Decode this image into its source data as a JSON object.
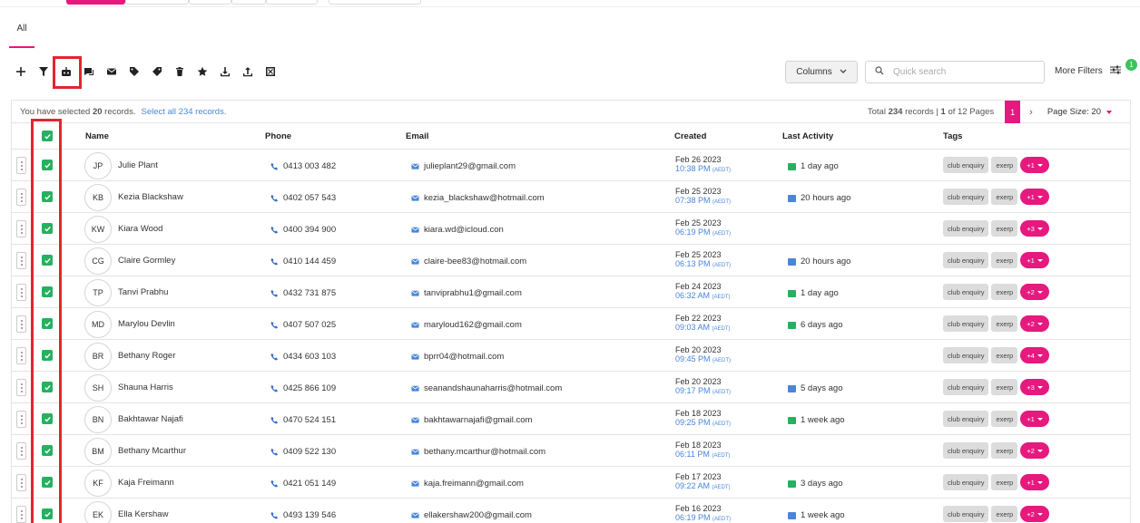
{
  "tabs": {
    "all_label": "All"
  },
  "toolbar": {
    "icons": [
      "add-icon",
      "filter-icon",
      "robot-icon",
      "chat-icon",
      "mail-icon",
      "tag-icon",
      "tag-remove-icon",
      "trash-icon",
      "star-icon",
      "download-icon",
      "upload-icon",
      "merge-icon"
    ],
    "columns_label": "Columns",
    "search_placeholder": "Quick search",
    "more_filters_label": "More Filters",
    "filter_count": "1"
  },
  "info": {
    "selected_prefix": "You have selected",
    "selected_count": "20",
    "selected_suffix": "records.",
    "select_all_label": "Select all 234 records.",
    "total_prefix": "Total",
    "total_count": "234",
    "records_mid": "records |",
    "page_current": "1",
    "page_of": "of 12 Pages",
    "page_size_label": "Page Size: 20"
  },
  "columns": {
    "name": "Name",
    "phone": "Phone",
    "email": "Email",
    "created": "Created",
    "last_activity": "Last Activity",
    "tags": "Tags"
  },
  "colors": {
    "accent": "#e5197e",
    "check": "#27b060",
    "highlight": "#e0262f",
    "link": "#4a86d8"
  },
  "rows": [
    {
      "initials": "JP",
      "name": "Julie Plant",
      "phone": "0413 003 482",
      "email": "julieplant29@gmail.com",
      "date": "Feb 26 2023",
      "time": "10:38 PM",
      "tz": "(AEDT)",
      "activity": "1 day ago",
      "activity_type": "chat",
      "tag1": "club enquiry",
      "tag2": "exerp",
      "more": "+1"
    },
    {
      "initials": "KB",
      "name": "Kezia Blackshaw",
      "phone": "0402 057 543",
      "email": "kezia_blackshaw@hotmail.com",
      "date": "Feb 25 2023",
      "time": "07:38 PM",
      "tz": "(AEDT)",
      "activity": "20 hours ago",
      "activity_type": "mail",
      "tag1": "club enquiry",
      "tag2": "exerp",
      "more": "+1"
    },
    {
      "initials": "KW",
      "name": "Kiara Wood",
      "phone": "0400 394 900",
      "email": "kiara.wd@icloud.con",
      "date": "Feb 25 2023",
      "time": "06:19 PM",
      "tz": "(AEDT)",
      "activity": "",
      "activity_type": "",
      "tag1": "club enquiry",
      "tag2": "exerp",
      "more": "+3"
    },
    {
      "initials": "CG",
      "name": "Claire Gormley",
      "phone": "0410 144 459",
      "email": "claire-bee83@hotmail.com",
      "date": "Feb 25 2023",
      "time": "06:13 PM",
      "tz": "(AEDT)",
      "activity": "20 hours ago",
      "activity_type": "mail",
      "tag1": "club enquiry",
      "tag2": "exerp",
      "more": "+1"
    },
    {
      "initials": "TP",
      "name": "Tanvi Prabhu",
      "phone": "0432 731 875",
      "email": "tanviprabhu1@gmail.com",
      "date": "Feb 24 2023",
      "time": "06:32 AM",
      "tz": "(AEDT)",
      "activity": "1 day ago",
      "activity_type": "chat",
      "tag1": "club enquiry",
      "tag2": "exerp",
      "more": "+2"
    },
    {
      "initials": "MD",
      "name": "Marylou Devlin",
      "phone": "0407 507 025",
      "email": "maryloud162@gmail.com",
      "date": "Feb 22 2023",
      "time": "09:03 AM",
      "tz": "(AEDT)",
      "activity": "6 days ago",
      "activity_type": "chat",
      "tag1": "club enquiry",
      "tag2": "exerp",
      "more": "+2"
    },
    {
      "initials": "BR",
      "name": "Bethany Roger",
      "phone": "0434 603 103",
      "email": "bprr04@hotmail.com",
      "date": "Feb 20 2023",
      "time": "09:45 PM",
      "tz": "(AEDT)",
      "activity": "",
      "activity_type": "",
      "tag1": "club enquiry",
      "tag2": "exerp",
      "more": "+4"
    },
    {
      "initials": "SH",
      "name": "Shauna Harris",
      "phone": "0425 866 109",
      "email": "seanandshaunaharris@hotmail.com",
      "date": "Feb 20 2023",
      "time": "09:17 PM",
      "tz": "(AEDT)",
      "activity": "5 days ago",
      "activity_type": "mail",
      "tag1": "club enquiry",
      "tag2": "exerp",
      "more": "+3"
    },
    {
      "initials": "BN",
      "name": "Bakhtawar Najafi",
      "phone": "0470 524 151",
      "email": "bakhtawarnajafi@gmail.com",
      "date": "Feb 18 2023",
      "time": "09:25 PM",
      "tz": "(AEDT)",
      "activity": "1 week ago",
      "activity_type": "chat",
      "tag1": "club enquiry",
      "tag2": "exerp",
      "more": "+1"
    },
    {
      "initials": "BM",
      "name": "Bethany Mcarthur",
      "phone": "0409 522 130",
      "email": "bethany.mcarthur@hotmail.com",
      "date": "Feb 18 2023",
      "time": "06:11 PM",
      "tz": "(AEDT)",
      "activity": "",
      "activity_type": "",
      "tag1": "club enquiry",
      "tag2": "exerp",
      "more": "+2"
    },
    {
      "initials": "KF",
      "name": "Kaja Freimann",
      "phone": "0421 051 149",
      "email": "kaja.freimann@gmail.com",
      "date": "Feb 17 2023",
      "time": "09:22 AM",
      "tz": "(AEDT)",
      "activity": "3 days ago",
      "activity_type": "chat",
      "tag1": "club enquiry",
      "tag2": "exerp",
      "more": "+1"
    },
    {
      "initials": "EK",
      "name": "Ella Kershaw",
      "phone": "0493 139 546",
      "email": "ellakershaw200@gmail.com",
      "date": "Feb 16 2023",
      "time": "06:19 PM",
      "tz": "(AEDT)",
      "activity": "1 week ago",
      "activity_type": "mail",
      "tag1": "club enquiry",
      "tag2": "exerp",
      "more": "+2"
    }
  ]
}
